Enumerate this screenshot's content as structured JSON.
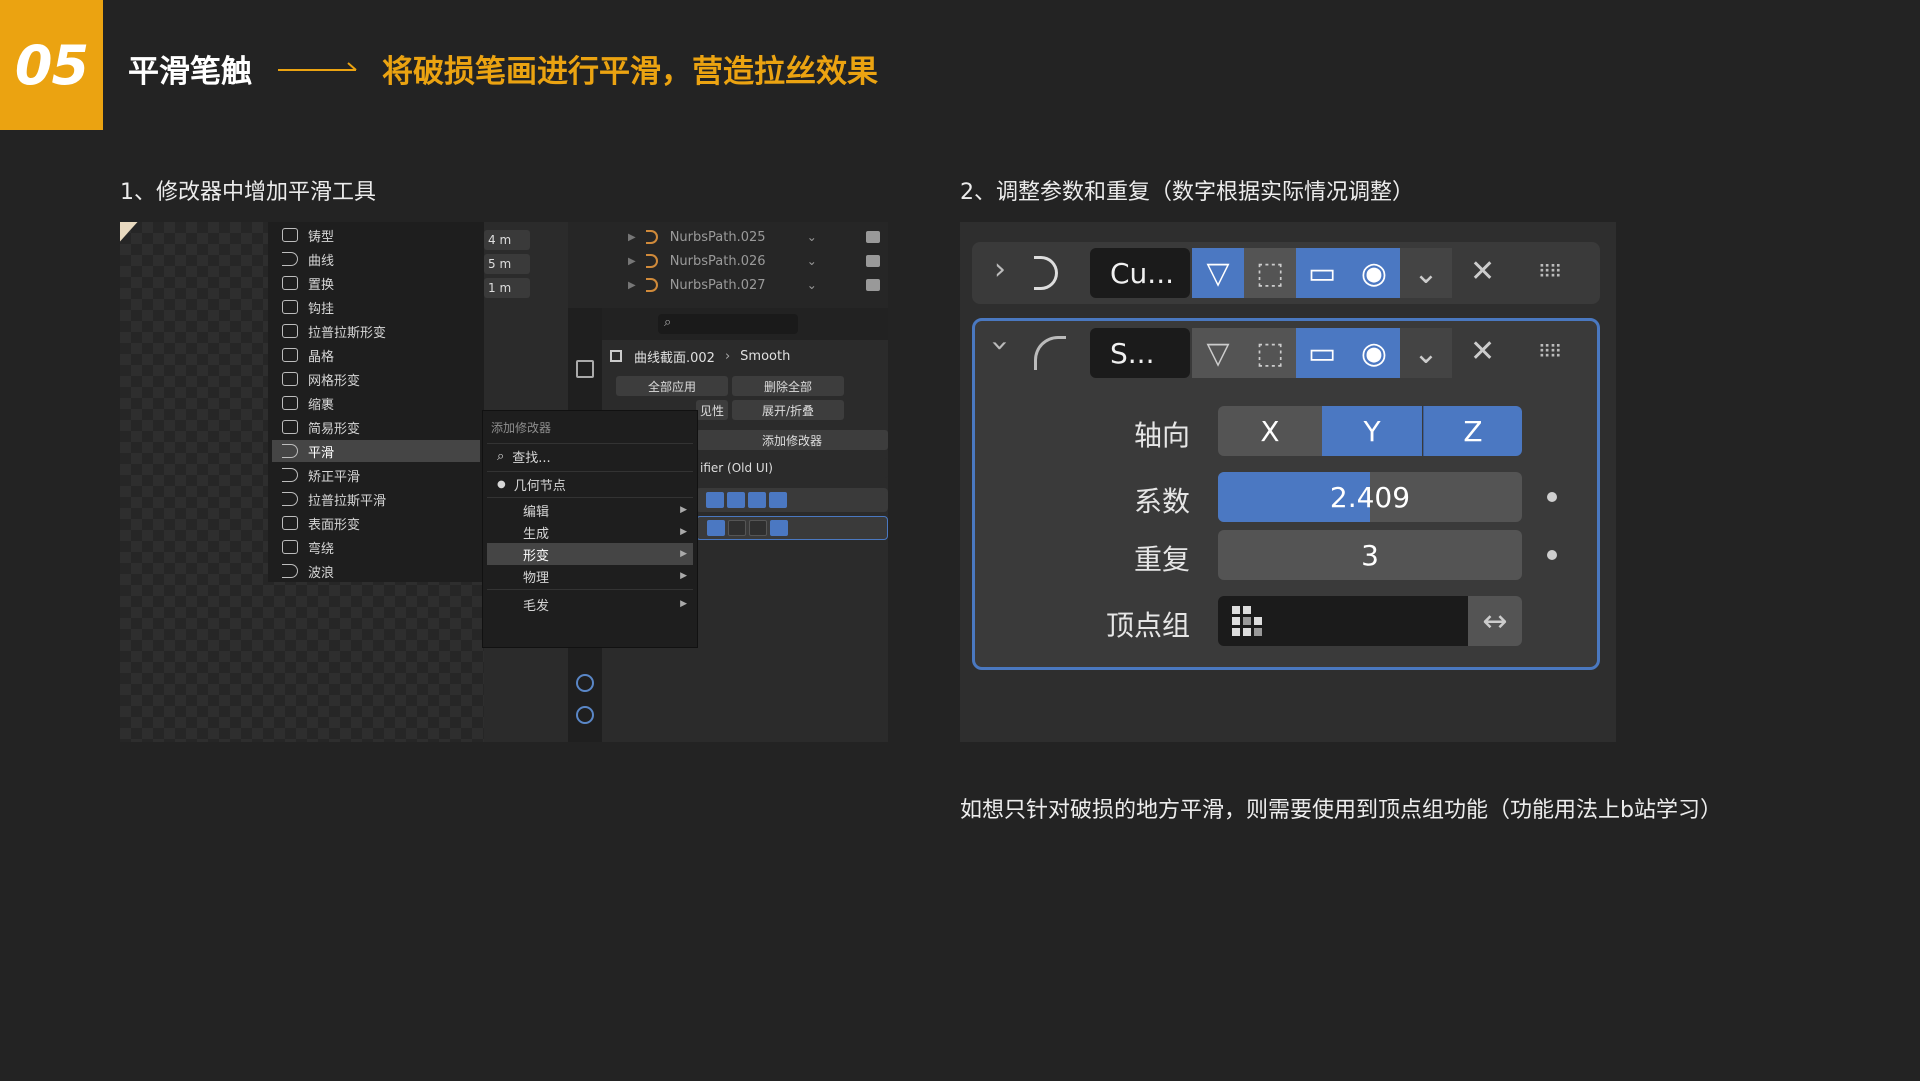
{
  "header": {
    "number": "05",
    "title": "平滑笔触",
    "subtitle": "将破损笔画进行平滑，营造拉丝效果"
  },
  "steps": {
    "step1": "1、修改器中增加平滑工具",
    "step2": "2、调整参数和重复（数字根据实际情况调整）"
  },
  "note": "如想只针对破损的地方平滑，则需要使用到顶点组功能（功能用法上b站学习）",
  "colors": {
    "accent": "#eba311",
    "blender_blue": "#4b78c2"
  },
  "shot1": {
    "deform_items": [
      "铸型",
      "曲线",
      "置换",
      "钩挂",
      "拉普拉斯形变",
      "晶格",
      "网格形变",
      "缩裹",
      "简易形变",
      "平滑",
      "矫正平滑",
      "拉普拉斯平滑",
      "表面形变",
      "弯绕",
      "波浪"
    ],
    "selected_deform": "平滑",
    "units": [
      "4 m",
      "5 m",
      "1 m"
    ],
    "outliner_rows": [
      "NurbsPath.025",
      "NurbsPath.026",
      "NurbsPath.027"
    ],
    "object_name": "曲线截面.002",
    "modifier_name": "Smooth",
    "buttons": {
      "apply_all": "全部应用",
      "delete_all": "删除全部",
      "visibility": "见性",
      "expand_collapse": "展开/折叠",
      "add_modifier": "添加修改器",
      "old_ui": "ifier (Old UI)"
    },
    "add_menu": {
      "title": "添加修改器",
      "search": "查找...",
      "geometry_nodes": "几何节点",
      "categories": [
        "编辑",
        "生成",
        "形变",
        "物理",
        "毛发"
      ],
      "selected_category": "形变"
    }
  },
  "shot2": {
    "modifier1_name": "Cu...",
    "modifier2_name": "S...",
    "axis_label": "轴向",
    "axes": [
      "X",
      "Y",
      "Z"
    ],
    "axes_active": [
      "Y",
      "Z"
    ],
    "factor_label": "系数",
    "factor_value": "2.409",
    "factor_fill": 0.5,
    "repeat_label": "重复",
    "repeat_value": "3",
    "vertex_group_label": "顶点组"
  }
}
